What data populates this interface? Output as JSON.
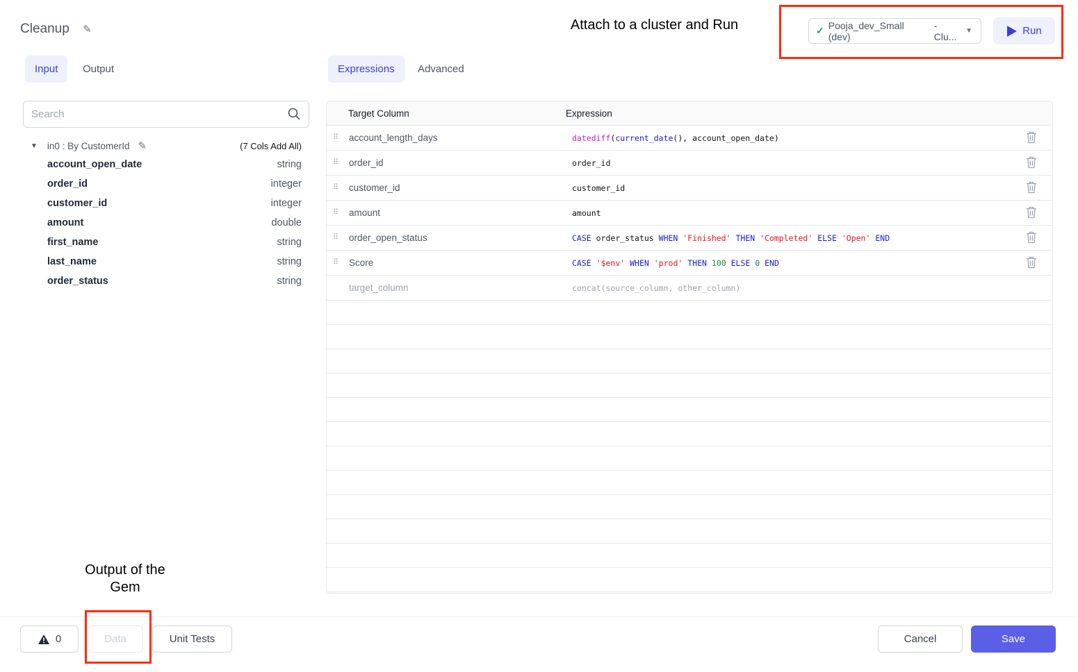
{
  "header": {
    "title": "Cleanup",
    "cluster_label": "Pooja_dev_Small (dev)",
    "cluster_suffix": "- Clu...",
    "run_label": "Run"
  },
  "annotations": {
    "attach": "Attach to a cluster and Run",
    "output": "Output of the Gem"
  },
  "left_tabs": [
    {
      "label": "Input",
      "active": true
    },
    {
      "label": "Output",
      "active": false
    }
  ],
  "right_tabs": [
    {
      "label": "Expressions",
      "active": true
    },
    {
      "label": "Advanced",
      "active": false
    }
  ],
  "search": {
    "placeholder": "Search"
  },
  "input_group": {
    "label": "in0 : By CustomerId",
    "add_all": "(7 Cols Add All)"
  },
  "fields": [
    {
      "name": "account_open_date",
      "type": "string"
    },
    {
      "name": "order_id",
      "type": "integer"
    },
    {
      "name": "customer_id",
      "type": "integer"
    },
    {
      "name": "amount",
      "type": "double"
    },
    {
      "name": "first_name",
      "type": "string"
    },
    {
      "name": "last_name",
      "type": "string"
    },
    {
      "name": "order_status",
      "type": "string"
    }
  ],
  "table": {
    "headers": {
      "target": "Target Column",
      "expression": "Expression"
    },
    "rows": [
      {
        "target": "account_length_days",
        "tokens": [
          [
            "datediff",
            "func"
          ],
          [
            "(",
            "plain"
          ],
          [
            "current_date",
            "call"
          ],
          [
            "(), account_open_date)",
            "plain"
          ]
        ]
      },
      {
        "target": "order_id",
        "tokens": [
          [
            "order_id",
            "plain"
          ]
        ]
      },
      {
        "target": "customer_id",
        "tokens": [
          [
            "customer_id",
            "plain"
          ]
        ]
      },
      {
        "target": "amount",
        "tokens": [
          [
            "amount",
            "plain"
          ]
        ]
      },
      {
        "target": "order_open_status",
        "tokens": [
          [
            "CASE",
            "kw"
          ],
          [
            " order_status ",
            "plain"
          ],
          [
            "WHEN",
            "kw"
          ],
          [
            " ",
            "plain"
          ],
          [
            "'Finished'",
            "str"
          ],
          [
            " ",
            "plain"
          ],
          [
            "THEN",
            "kw"
          ],
          [
            " ",
            "plain"
          ],
          [
            "'Completed'",
            "str"
          ],
          [
            " ",
            "plain"
          ],
          [
            "ELSE",
            "kw"
          ],
          [
            " ",
            "plain"
          ],
          [
            "'Open'",
            "str"
          ],
          [
            " ",
            "plain"
          ],
          [
            "END",
            "kw"
          ]
        ]
      },
      {
        "target": "Score",
        "tokens": [
          [
            "CASE",
            "kw"
          ],
          [
            " ",
            "plain"
          ],
          [
            "'$env'",
            "str"
          ],
          [
            " ",
            "plain"
          ],
          [
            "WHEN",
            "kw"
          ],
          [
            " ",
            "plain"
          ],
          [
            "'prod'",
            "str"
          ],
          [
            " ",
            "plain"
          ],
          [
            "THEN",
            "kw"
          ],
          [
            " ",
            "plain"
          ],
          [
            "100",
            "num"
          ],
          [
            " ",
            "plain"
          ],
          [
            "ELSE",
            "kw"
          ],
          [
            " ",
            "plain"
          ],
          [
            "0",
            "num"
          ],
          [
            " ",
            "plain"
          ],
          [
            "END",
            "kw"
          ]
        ]
      }
    ],
    "placeholder": {
      "target": "target_column",
      "expression": "concat(source_column, other_column)"
    }
  },
  "footer": {
    "warnings": "0",
    "data_label": "Data",
    "unit_tests_label": "Unit Tests",
    "cancel_label": "Cancel",
    "save_label": "Save"
  },
  "colors": {
    "accent": "#5b5ee6",
    "annotation_box": "#ff2a0a",
    "check": "#16a34a"
  }
}
